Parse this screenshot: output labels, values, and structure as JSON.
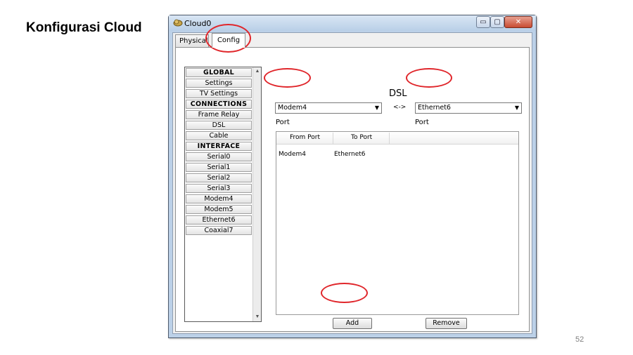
{
  "slide": {
    "title": "Konfigurasi Cloud",
    "page_number": "52"
  },
  "window": {
    "title": "Cloud0",
    "controls": {
      "minimize": "▭",
      "maximize": "▢",
      "close": "✕"
    }
  },
  "tabs": [
    {
      "label": "Physical"
    },
    {
      "label": "Config"
    }
  ],
  "sidebar": {
    "items": [
      {
        "label": "GLOBAL",
        "header": true
      },
      {
        "label": "Settings"
      },
      {
        "label": "TV Settings"
      },
      {
        "label": "CONNECTIONS",
        "header": true
      },
      {
        "label": "Frame Relay"
      },
      {
        "label": "DSL"
      },
      {
        "label": "Cable"
      },
      {
        "label": "INTERFACE",
        "header": true
      },
      {
        "label": "Serial0"
      },
      {
        "label": "Serial1"
      },
      {
        "label": "Serial2"
      },
      {
        "label": "Serial3"
      },
      {
        "label": "Modem4"
      },
      {
        "label": "Modem5"
      },
      {
        "label": "Ethernet6"
      },
      {
        "label": "Coaxial7"
      }
    ]
  },
  "dsl_panel": {
    "heading": "DSL",
    "arrow": "<->",
    "left_port": {
      "value": "Modem4",
      "label": "Port"
    },
    "right_port": {
      "value": "Ethernet6",
      "label": "Port"
    },
    "table": {
      "columns": [
        "From Port",
        "To Port"
      ],
      "rows": [
        {
          "from": "Modem4",
          "to": "Ethernet6"
        }
      ]
    },
    "add_label": "Add",
    "remove_label": "Remove"
  },
  "colors": {
    "annotation": "#e0262b",
    "titlebar": "#bcd1e8"
  }
}
